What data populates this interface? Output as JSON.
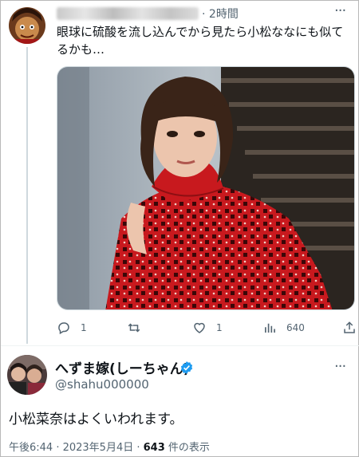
{
  "reply_tweet": {
    "time": "2時間",
    "more": "···",
    "text": "眼球に硫酸を流し込んでから見たら小松ななにも似てるかも…",
    "actions": {
      "replies": "1",
      "retweets": "",
      "likes": "1",
      "views": "640"
    }
  },
  "main_tweet": {
    "display_name": "へずま嫁(しーちゃん)",
    "handle": "@shahu000000",
    "more": "···",
    "text": "小松菜奈はよくいわれます。",
    "timestamp": "午後6:44 · 2023年5月4日 · ",
    "view_count": "643",
    "view_suffix": " 件の表示"
  },
  "colors": {
    "text_primary": "#0f1419",
    "text_secondary": "#536471",
    "verified_blue": "#1d9bf0",
    "thread_line": "#cfd9de",
    "sweater_red": "#c8191e"
  },
  "icons": [
    "reply-icon",
    "retweet-icon",
    "like-icon",
    "views-icon",
    "share-icon",
    "verified-badge-icon",
    "more-icon"
  ]
}
